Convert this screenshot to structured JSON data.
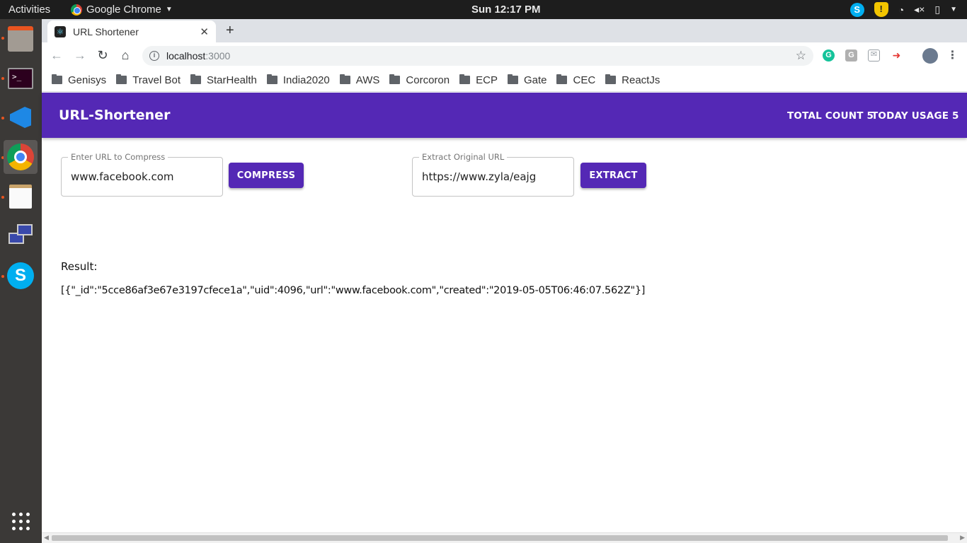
{
  "system": {
    "activities": "Activities",
    "app_menu": "Google Chrome",
    "clock": "Sun 12:17 PM"
  },
  "browser": {
    "tab_title": "URL Shortener",
    "address_host": "localhost",
    "address_port": ":3000",
    "bookmarks": [
      "Genisys",
      "Travel Bot",
      "StarHealth",
      "India2020",
      "AWS",
      "Corcoron",
      "ECP",
      "Gate",
      "CEC",
      "ReactJs"
    ]
  },
  "app": {
    "title": "URL-Shortener",
    "total_count": "TOTAL COUNT 5",
    "today_usage": "TODAY USAGE 5",
    "compress": {
      "label": "Enter URL to Compress",
      "value": "www.facebook.com",
      "button": "COMPRESS"
    },
    "extract": {
      "label": "Extract Original URL",
      "value": "https://www.zyla/eajg",
      "button": "EXTRACT"
    },
    "result_label": "Result:",
    "result_text": "[{\"_id\":\"5cce86af3e67e3197cfece1a\",\"uid\":4096,\"url\":\"www.facebook.com\",\"created\":\"2019-05-05T06:46:07.562Z\"}]"
  },
  "colors": {
    "appbar": "#5428b5",
    "button": "#5428b5"
  }
}
